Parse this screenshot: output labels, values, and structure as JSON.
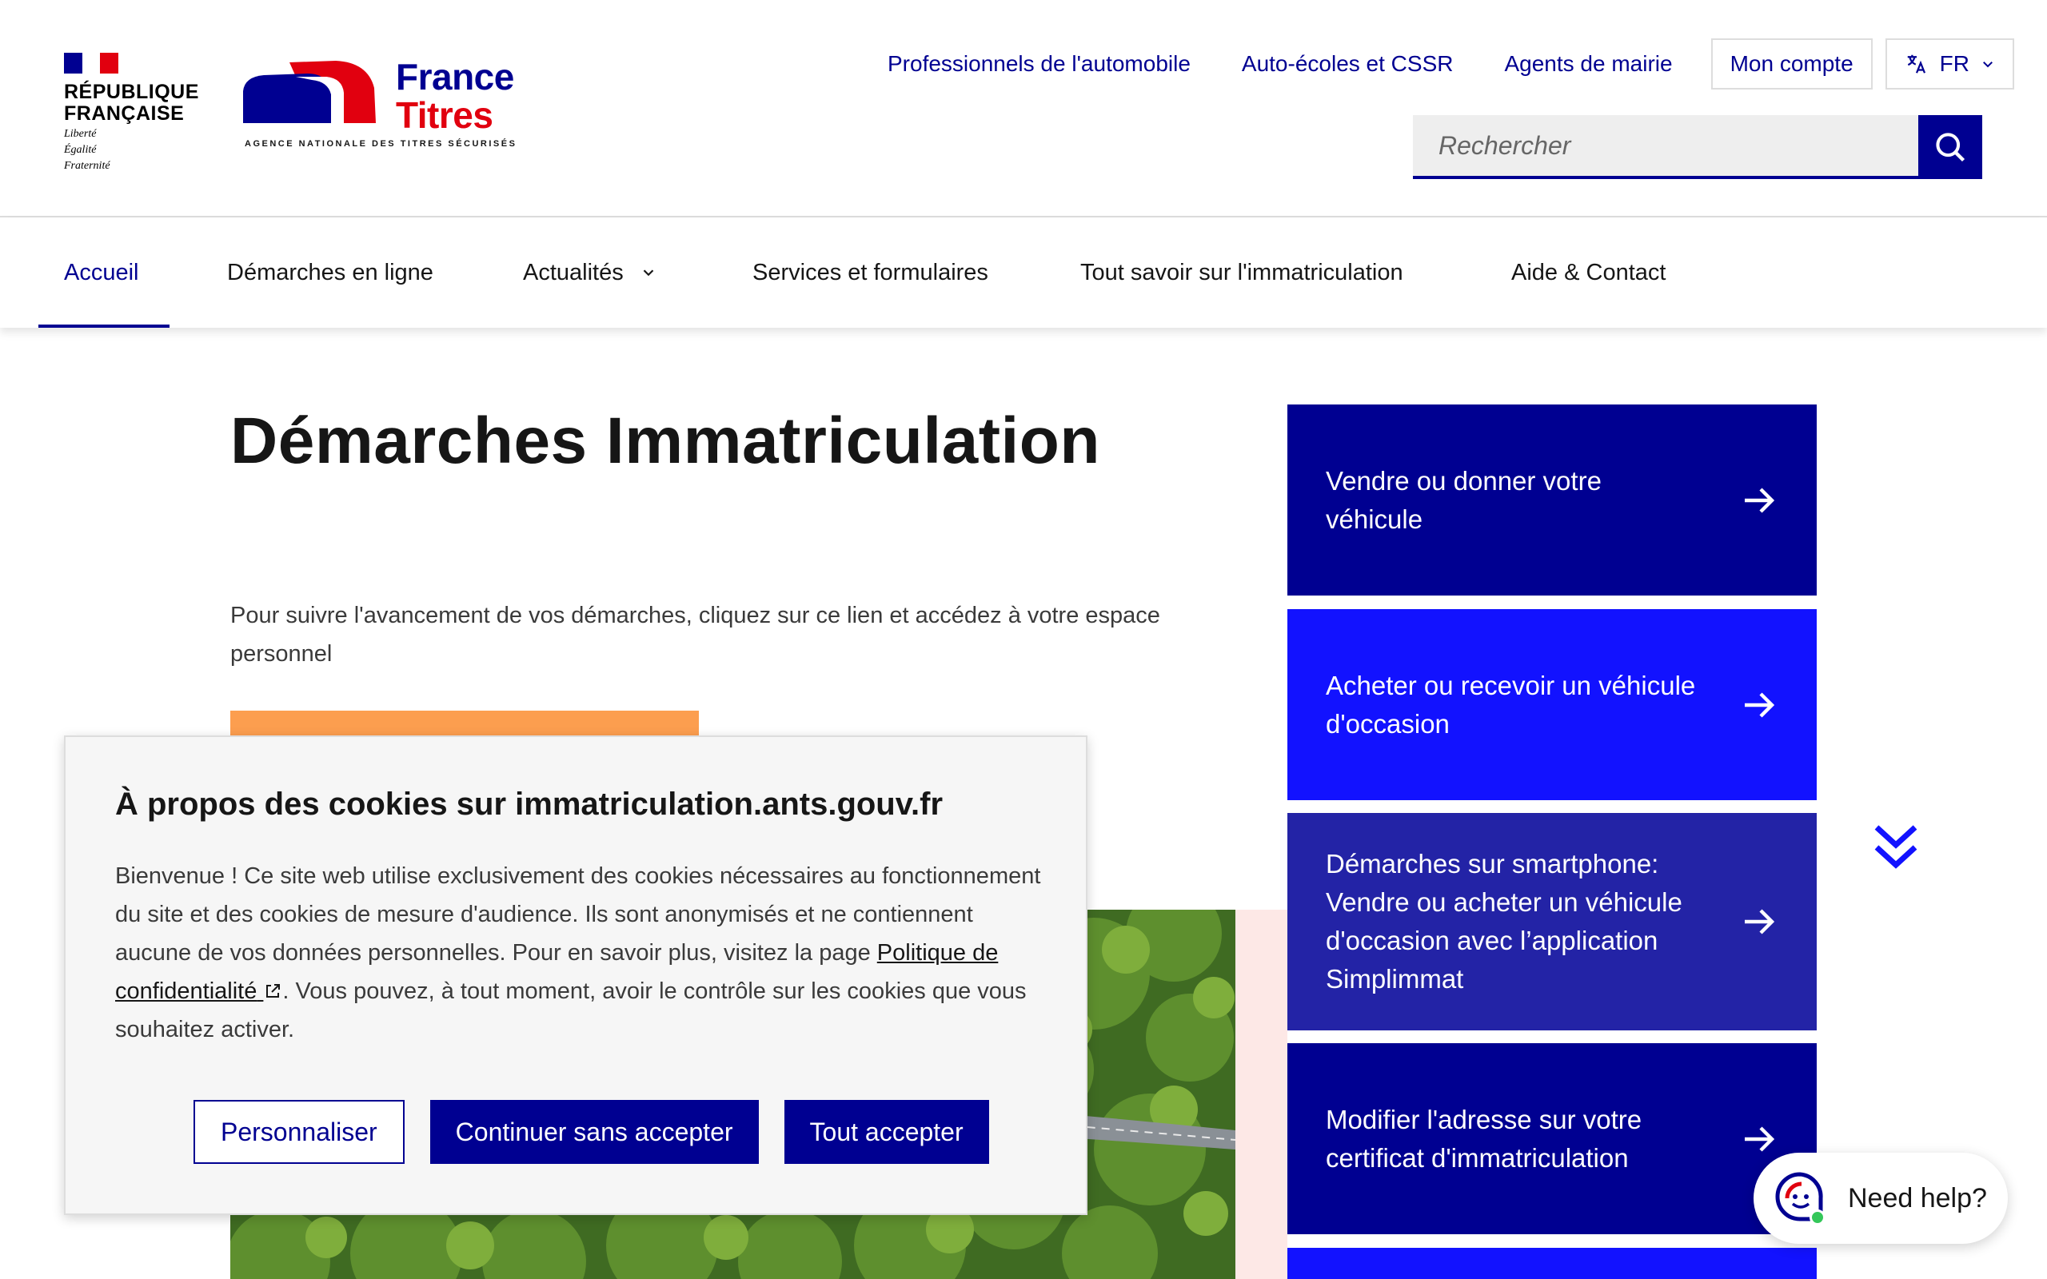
{
  "header": {
    "rf": {
      "name_line1": "RÉPUBLIQUE",
      "name_line2": "FRANÇAISE",
      "motto1": "Liberté",
      "motto2": "Égalité",
      "motto3": "Fraternité"
    },
    "brand": {
      "line1": "France",
      "line2": "Titres",
      "tagline": "AGENCE NATIONALE DES TITRES SÉCURISÉS"
    },
    "links": [
      {
        "label": "Professionnels de l'automobile"
      },
      {
        "label": "Auto-écoles et CSSR"
      },
      {
        "label": "Agents de mairie"
      }
    ],
    "account_label": "Mon compte",
    "lang_label": "FR",
    "search": {
      "placeholder": "Rechercher",
      "button_icon": "search-icon"
    }
  },
  "nav": {
    "items": [
      {
        "label": "Accueil",
        "active": true
      },
      {
        "label": "Démarches en ligne"
      },
      {
        "label": "Actualités",
        "has_dropdown": true
      },
      {
        "label": "Services et formulaires"
      },
      {
        "label": "Tout savoir sur l'immatriculation"
      },
      {
        "label": "Aide & Contact"
      }
    ]
  },
  "main": {
    "title": "Démarches Immatriculation",
    "intro": "Pour suivre l'avancement de vos démarches, cliquez sur ce lien et accédez à votre espace personnel"
  },
  "cards": [
    {
      "label": "Vendre ou donner votre véhicule",
      "color": "#000091"
    },
    {
      "label": "Acheter ou recevoir un véhicule d'occasion",
      "color": "#1212ff"
    },
    {
      "label": "Démarches sur smartphone: Vendre ou acheter un véhicule d'occasion avec l’application Simplimmat",
      "color": "#2323a6"
    },
    {
      "label": "Modifier l'adresse sur votre certificat d'immatriculation",
      "color": "#000091"
    }
  ],
  "cookie": {
    "title": "À propos des cookies sur immatriculation.ants.gouv.fr",
    "text_before": "Bienvenue ! Ce site web utilise exclusivement des cookies nécessaires au fonctionnement du site et des cookies de mesure d'audience. Ils sont anonymisés et ne contiennent aucune de vos données personnelles. Pour en savoir plus, visitez la page ",
    "link_label": "Politique de confidentialité",
    "text_after": ". Vous pouvez, à tout moment, avoir le contrôle sur les cookies que vous souhaitez activer.",
    "buttons": {
      "customize": "Personnaliser",
      "decline": "Continuer sans accepter",
      "accept": "Tout accepter"
    }
  },
  "help_widget": {
    "label": "Need help?"
  },
  "colors": {
    "primary": "#000091",
    "accent_red": "#e1000f",
    "orange": "#fc9e4f",
    "pink_panel": "#fde8e6"
  }
}
